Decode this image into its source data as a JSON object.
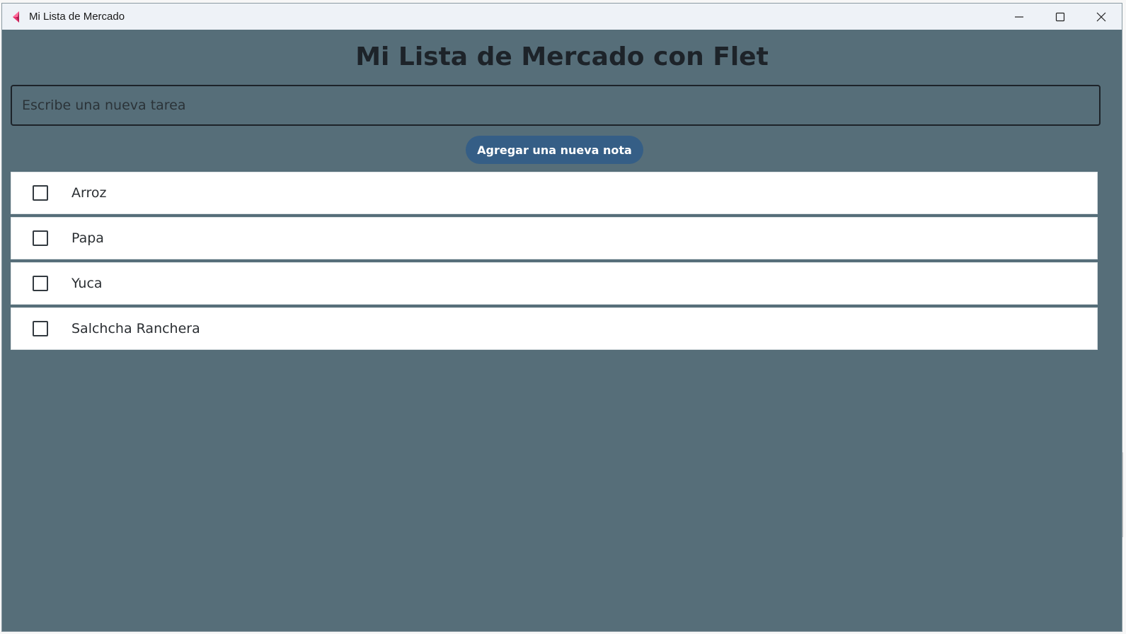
{
  "window": {
    "title": "Mi Lista de Mercado",
    "icon": "flet-logo-icon",
    "controls": {
      "minimize_icon": "minimize-icon",
      "maximize_icon": "maximize-icon",
      "close_icon": "close-icon"
    }
  },
  "main": {
    "title": "Mi Lista de Mercado con Flet",
    "task_input": {
      "placeholder": "Escribe una nueva tarea",
      "value": ""
    },
    "add_button_label": "Agregar una nueva nota",
    "items": [
      {
        "label": "Arroz",
        "checked": false
      },
      {
        "label": "Papa",
        "checked": false
      },
      {
        "label": "Yuca",
        "checked": false
      },
      {
        "label": "Salchcha Ranchera",
        "checked": false
      }
    ]
  },
  "colors": {
    "background": "#566e79",
    "titlebar": "#eef2f7",
    "button": "#355e86",
    "item_background": "#ffffff",
    "title_text": "#1d2329"
  }
}
